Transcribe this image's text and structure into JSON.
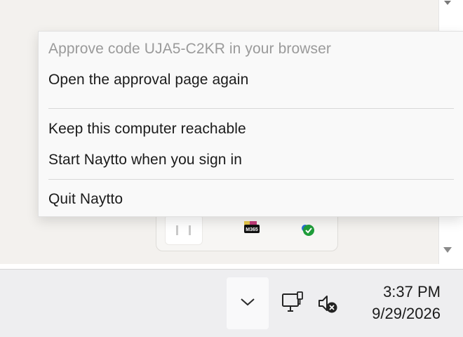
{
  "context_menu": {
    "items": [
      {
        "label": "Approve code UJA5-C2KR in your browser",
        "enabled": false
      },
      {
        "label": "Open the approval page again",
        "enabled": true
      },
      {
        "label": "Keep this computer reachable",
        "enabled": true
      },
      {
        "label": "Start Naytto when you sign in",
        "enabled": true
      },
      {
        "label": "Quit Naytto",
        "enabled": true
      }
    ]
  },
  "tray_flyout": {
    "icons": [
      {
        "name": "pinned-app-icon"
      },
      {
        "name": "m365-icon",
        "badge": "M365"
      },
      {
        "name": "sync-status-icon"
      }
    ]
  },
  "taskbar": {
    "show_hidden_icons": "chevron-up-icon",
    "network_icon": "network-icon",
    "volume_icon": "volume-muted-icon",
    "clock": {
      "time": "3:37 PM",
      "date": "9/29/2026"
    }
  }
}
